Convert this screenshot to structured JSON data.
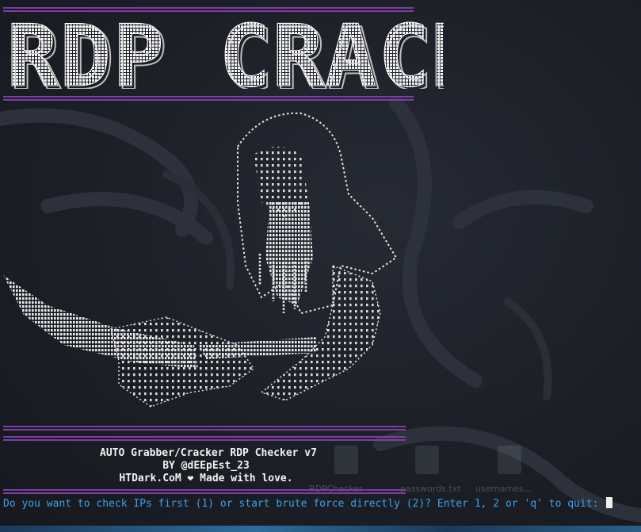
{
  "banner": {
    "title": "RDP CRACK"
  },
  "credits": {
    "line1": "AUTO Grabber/Cracker RDP Checker v7",
    "line2": "BY @dEEpEst_23",
    "line3": "HTDark.CoM ❤ Made with love."
  },
  "prompt": {
    "text": "Do you want to check IPs first (1) or start brute force directly (2)? Enter 1, 2 or 'q' to quit: "
  },
  "desktop_icons": [
    {
      "label": "RDPChecker",
      "icon": "python-file-icon"
    },
    {
      "label": "passwords.txt",
      "icon": "text-file-icon"
    },
    {
      "label": "usernames...",
      "icon": "text-file-icon"
    }
  ],
  "colors": {
    "background": "#1c1f26",
    "divider": "#7a3fa0",
    "prompt": "#3aa0e8",
    "text": "#f2f2f2"
  }
}
